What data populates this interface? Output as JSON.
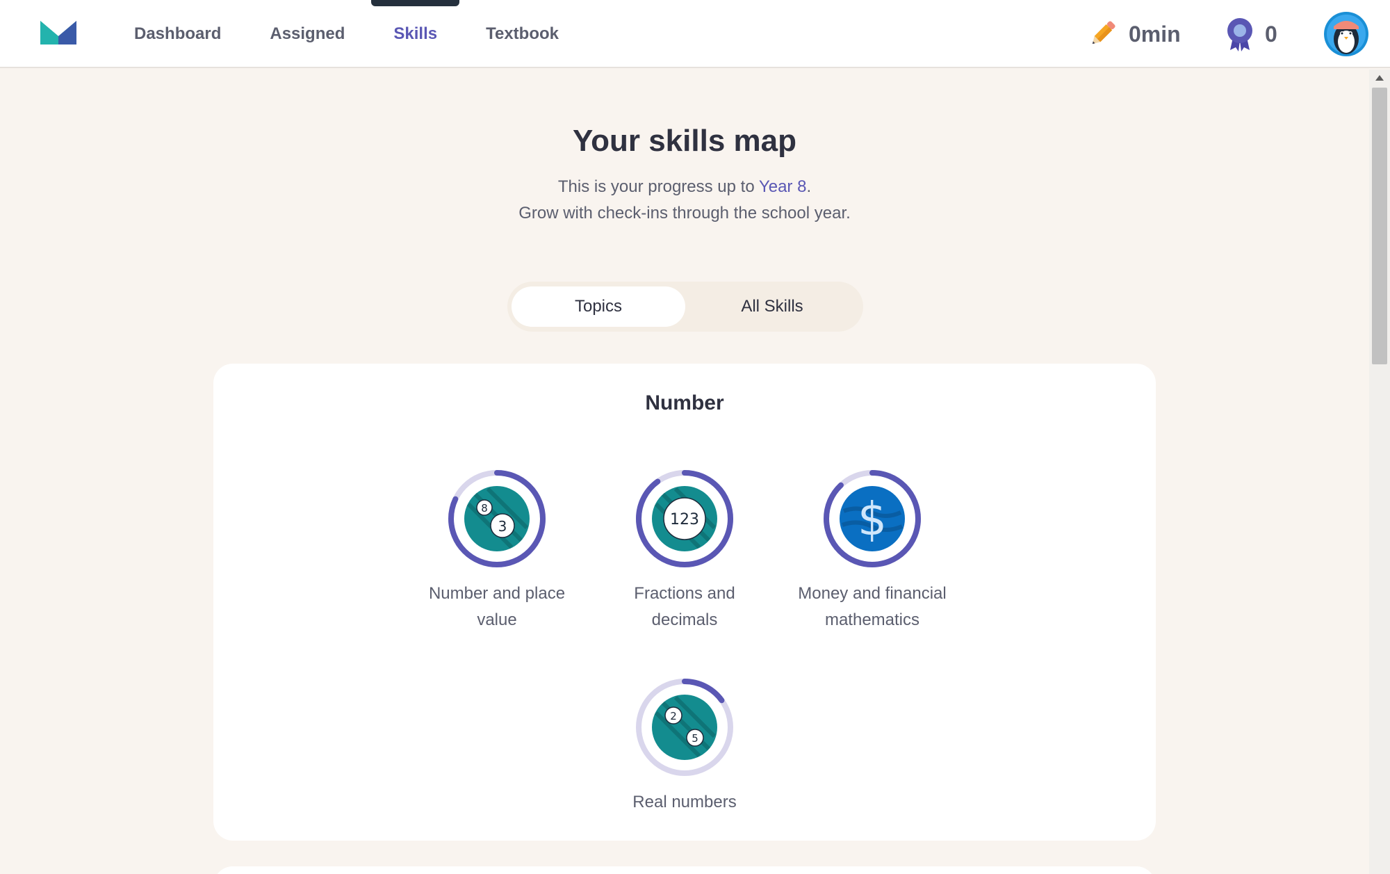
{
  "header": {
    "nav": [
      {
        "label": "Dashboard"
      },
      {
        "label": "Assigned"
      },
      {
        "label": "Skills"
      },
      {
        "label": "Textbook"
      }
    ],
    "minutes": "0min",
    "awards": "0"
  },
  "main": {
    "title": "Your skills map",
    "subtitle_prefix": "This is your progress up to ",
    "subtitle_year": "Year 8",
    "subtitle_suffix": ".",
    "subtitle_line2": "Grow with check-ins through the school year.",
    "tabs": [
      {
        "label": "Topics",
        "selected": true
      },
      {
        "label": "All Skills",
        "selected": false
      }
    ],
    "section": {
      "title": "Number",
      "topics": [
        {
          "label": "Number and place value",
          "icon": "place-value-icon",
          "progress": 0.82
        },
        {
          "label": "Fractions and decimals",
          "icon": "fractions-icon",
          "progress": 0.9
        },
        {
          "label": "Money and financial mathematics",
          "icon": "dollar-icon",
          "progress": 0.88
        },
        {
          "label": "Real numbers",
          "icon": "real-numbers-icon",
          "progress": 0.15
        }
      ]
    }
  },
  "colors": {
    "accent": "#5a57b4",
    "ring_track": "#d9d6ec",
    "teal": "#138c8f",
    "blue": "#0a6fc2",
    "background": "#f9f4ef"
  }
}
